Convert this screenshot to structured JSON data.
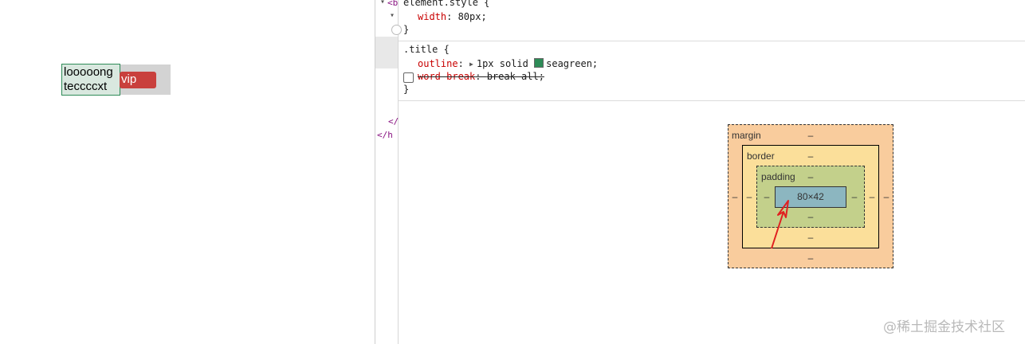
{
  "preview": {
    "title_text": "looooong teccccxt",
    "badge_text": "vip"
  },
  "dom_tree": {
    "fragments": [
      "<b",
      "</",
      "</h"
    ]
  },
  "styles": {
    "element_style": {
      "selector": "element.style {",
      "prop": "width",
      "value": "80px;",
      "close": "}"
    },
    "title_rule": {
      "selector": ".title {",
      "outline_prop": "outline",
      "outline_value": "1px solid",
      "outline_color_name": "seagreen;",
      "outline_color": "#2e8b57",
      "wordbreak_prop": "word-break",
      "wordbreak_value": "break-all;",
      "wordbreak_enabled": false,
      "close": "}"
    }
  },
  "box_model": {
    "margin_label": "margin",
    "border_label": "border",
    "padding_label": "padding",
    "content_size": "80×42",
    "empty": "–"
  },
  "watermark": "@稀土掘金技术社区"
}
